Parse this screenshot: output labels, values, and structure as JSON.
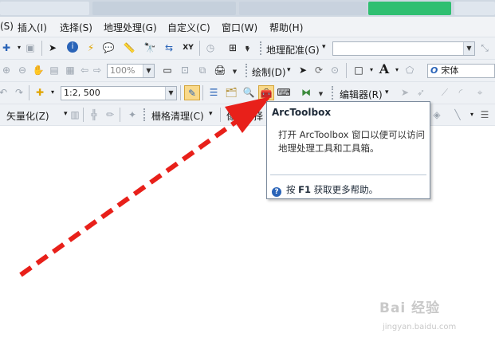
{
  "menu": {
    "items": [
      "(S)",
      "插入(I)",
      "选择(S)",
      "地理处理(G)",
      "自定义(C)",
      "窗口(W)",
      "帮助(H)"
    ]
  },
  "toolbar1": {
    "georef_label": "地理配准(G)",
    "georef_arrow": "▾"
  },
  "toolbar2": {
    "zoom_value": "100%",
    "draw_label": "绘制(D)",
    "font_name": "宋体",
    "text_tool_glyph": "A"
  },
  "toolbar3": {
    "scale_value": "1:2, 500",
    "editor_label": "编辑器(R)"
  },
  "toolbar4": {
    "vectorize_label": "矢量化(Z)",
    "raster_cleanup_label": "栅格清理(C)",
    "partial_label": "像",
    "partial_label2": "择"
  },
  "tooltip": {
    "title": "ArcToolbox",
    "body": "打开 ArcToolbox 窗口以便可以访问地理处理工具和工具箱。",
    "help_prefix": "按 ",
    "help_key": "F1",
    "help_suffix": " 获取更多帮助。",
    "help_icon_glyph": "?"
  },
  "watermark": {
    "logo": "Bai 经验",
    "url": "jingyan.baidu.com"
  },
  "colors": {
    "arrow": "#e8201a",
    "toolbar_bg": "#eef1f5",
    "highlight": "#f9d98a",
    "tooltip_border": "#7b8a9c"
  }
}
